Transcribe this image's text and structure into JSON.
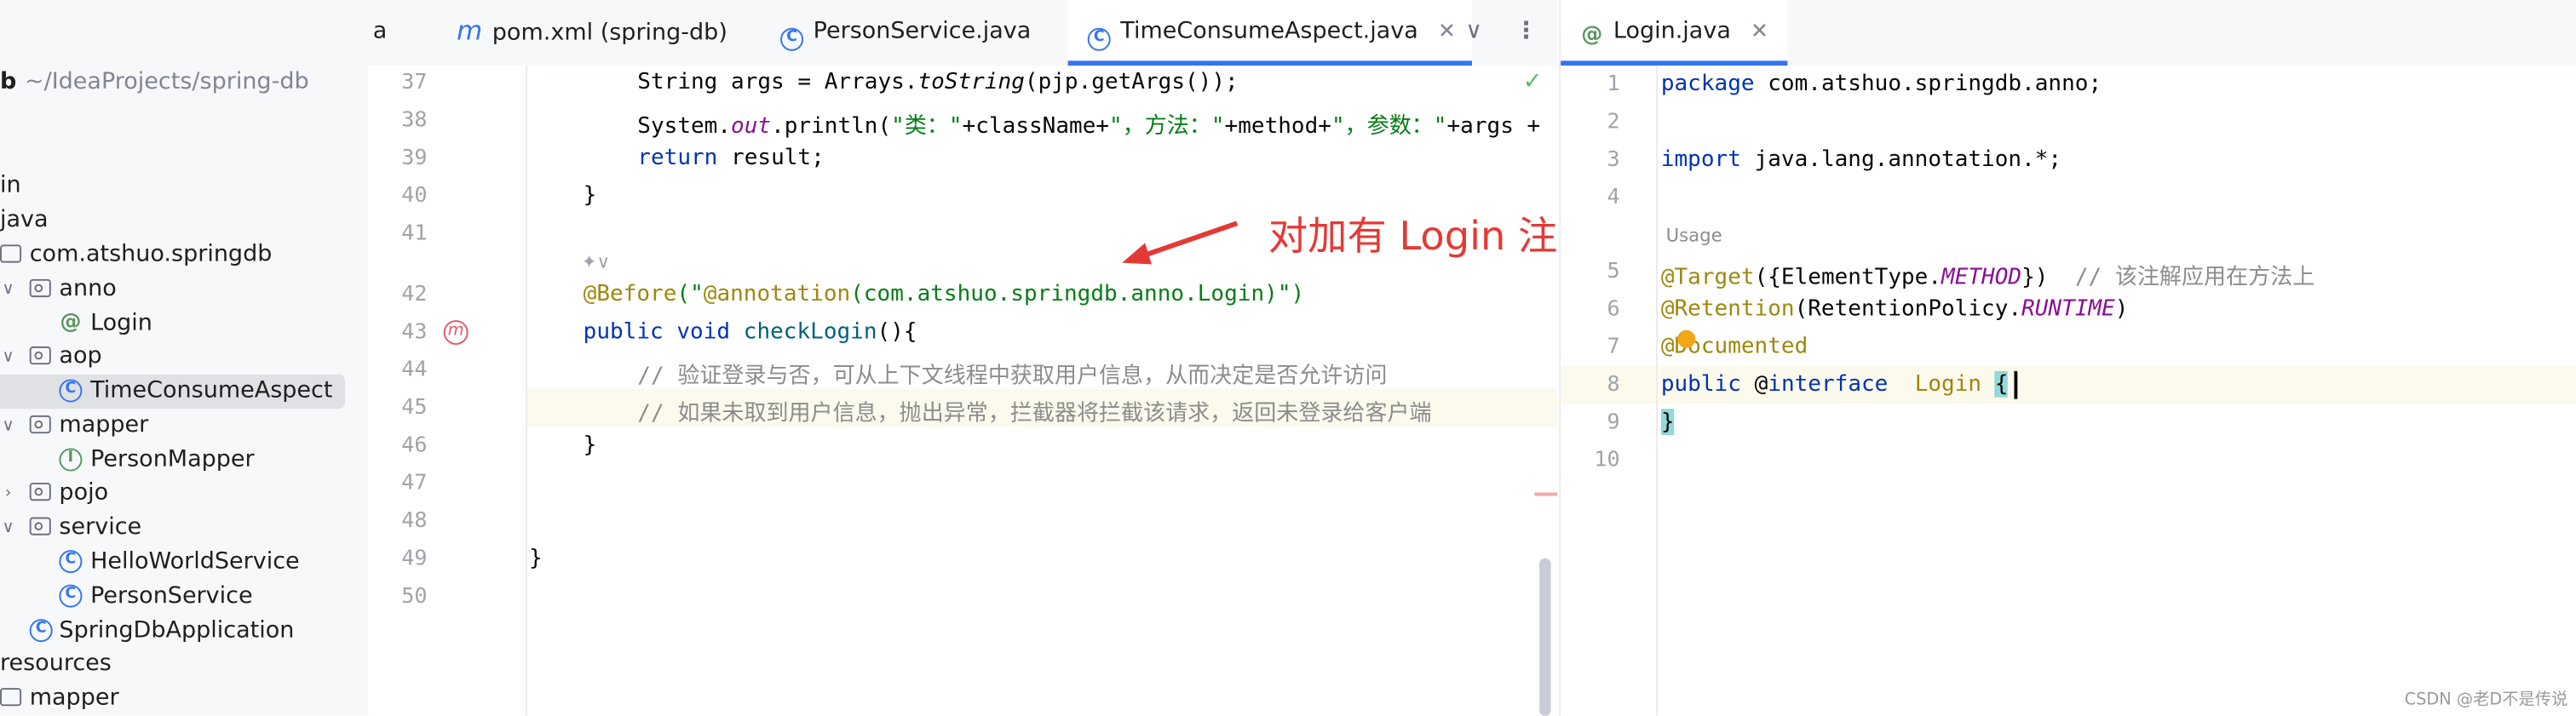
{
  "tabs_left": [
    {
      "label": "a",
      "active": false
    },
    {
      "label": "pom.xml (spring-db)",
      "active": false,
      "icon": "maven-icon"
    },
    {
      "label": "PersonService.java",
      "active": false,
      "icon": "class-icon"
    },
    {
      "label": "TimeConsumeAspect.java",
      "active": true,
      "icon": "class-icon"
    }
  ],
  "tabs_right": [
    {
      "label": "Login.java",
      "active": true,
      "icon": "annotation-icon"
    }
  ],
  "project": {
    "root_label": "b",
    "root_path": "~/IdeaProjects/spring-db",
    "items": [
      {
        "label": "in"
      },
      {
        "label": "java"
      },
      {
        "label": "com.atshuo.springdb"
      },
      {
        "label": "anno"
      },
      {
        "label": "Login"
      },
      {
        "label": "aop"
      },
      {
        "label": "TimeConsumeAspect"
      },
      {
        "label": "mapper"
      },
      {
        "label": "PersonMapper"
      },
      {
        "label": "pojo"
      },
      {
        "label": "service"
      },
      {
        "label": "HelloWorldService"
      },
      {
        "label": "PersonService"
      },
      {
        "label": "SpringDbApplication"
      },
      {
        "label": "resources"
      },
      {
        "label": "mapper"
      }
    ]
  },
  "left_editor": {
    "line_numbers": [
      "37",
      "38",
      "39",
      "40",
      "41",
      "42",
      "43",
      "44",
      "45",
      "46",
      "47",
      "48",
      "49",
      "50"
    ],
    "code": {
      "l37a": "String args = Arrays.",
      "l37b": "toString",
      "l37c": "(pjp.getArgs());",
      "l38a": "System.",
      "l38b": "out",
      "l38c": ".println(",
      "l38d": "\"类：\"",
      "l38e": "+className+",
      "l38f": "\"，方法：\"",
      "l38g": "+method+",
      "l38h": "\"，参数：\"",
      "l38i": "+args +",
      "l39a": "return",
      "l39b": " result;",
      "l40": "}",
      "l42a": "@Before",
      "l42b": "(\"",
      "l42c": "@annotation",
      "l42d": "(com.atshuo.springdb.anno.Login)",
      "l42e": "\")",
      "l43a": "public void",
      "l43b": "checkLogin",
      "l43c": "(){",
      "l44": "// 验证登录与否，可从上下文线程中获取用户信息，从而决定是否允许访问",
      "l45": "// 如果未取到用户信息，抛出异常，拦截器将拦截该请求，返回未登录给客户端",
      "l46": "}",
      "l49": "}"
    },
    "annotation_tip": "对加有 Login 注解的方法进行拦截"
  },
  "right_editor": {
    "line_numbers": [
      "1",
      "2",
      "3",
      "4",
      "5",
      "6",
      "7",
      "8",
      "9",
      "10"
    ],
    "code": {
      "l1a": "package",
      "l1b": " com.atshuo.springdb.anno;",
      "l3a": "import",
      "l3b": " java.lang.annotation.*;",
      "l4": "Usage",
      "l5a": "@Target",
      "l5b": "({ElementType.",
      "l5c": "METHOD",
      "l5d": "})",
      "l5e": "  // 该注解应用在方法上",
      "l6a": "@Retention",
      "l6b": "(RetentionPolicy.",
      "l6c": "RUNTIME",
      "l6d": ")",
      "l7": "@Documented",
      "l8a": "public",
      "l8b": " @",
      "l8c": "interface",
      "l8d": "  Login ",
      "l8e": "{",
      "l9": "}"
    }
  },
  "watermark": "CSDN @老D不是传说",
  "colors": {
    "accent": "#3574f0",
    "keyword": "#0033b3",
    "string": "#067d17",
    "annotation": "#9e880d",
    "comment": "#8c8c8c",
    "tip": "#e53935"
  }
}
